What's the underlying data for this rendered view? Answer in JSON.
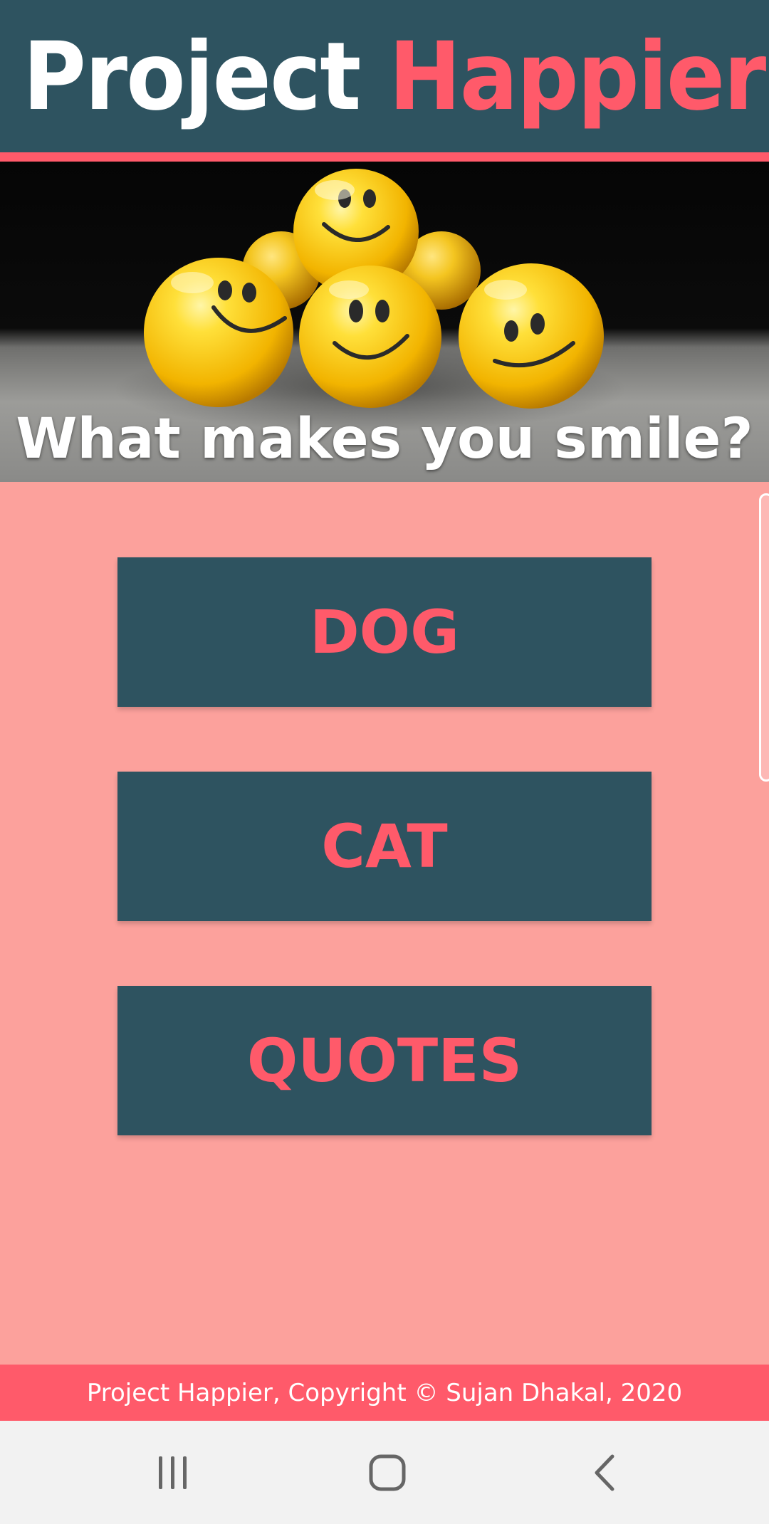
{
  "header": {
    "title_part1": "Project",
    "title_part2": "Happier"
  },
  "hero": {
    "caption": "What makes you smile?",
    "image": "yellow smiley balls"
  },
  "menu": {
    "buttons": [
      {
        "label": "DOG"
      },
      {
        "label": "CAT"
      },
      {
        "label": "QUOTES"
      }
    ]
  },
  "footer": {
    "text": "Project Happier, Copyright © Sujan Dhakal, 2020"
  },
  "navigation": {
    "icons": [
      "recent-apps-icon",
      "home-icon",
      "back-icon"
    ]
  },
  "colors": {
    "primary": "#2e5360",
    "accent": "#ff5a6a",
    "background": "#fca19c",
    "white": "#ffffff"
  }
}
